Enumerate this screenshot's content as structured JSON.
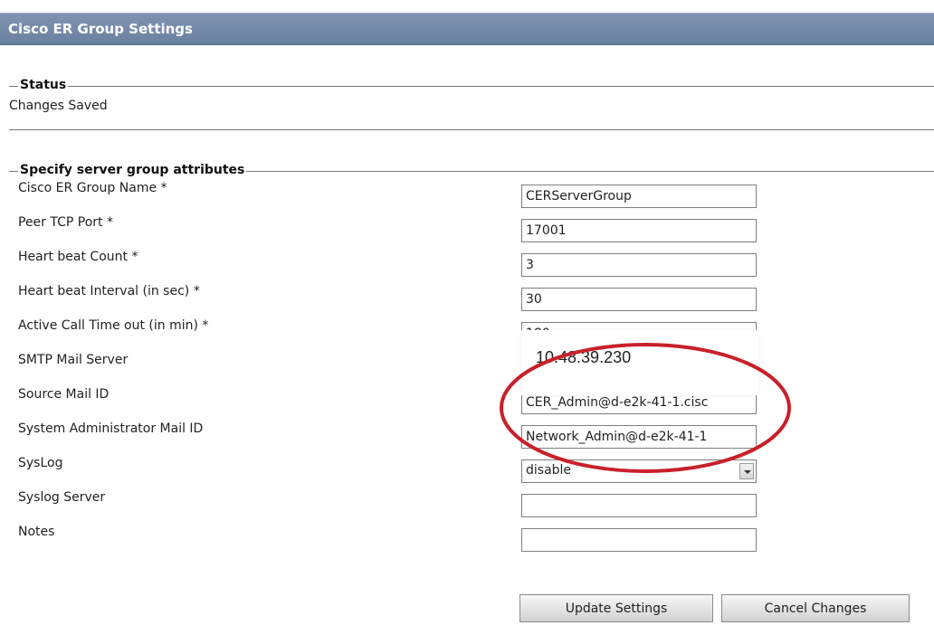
{
  "header": {
    "title": "Cisco ER Group Settings"
  },
  "status": {
    "legend": "Status",
    "message": "Changes Saved"
  },
  "attributes": {
    "legend": "Specify server group attributes",
    "rows": [
      {
        "label": "Cisco ER Group Name *",
        "value": "CERServerGroup"
      },
      {
        "label": "Peer TCP Port *",
        "value": "17001"
      },
      {
        "label": "Heart beat Count *",
        "value": "3"
      },
      {
        "label": "Heart beat Interval (in sec) *",
        "value": "30"
      },
      {
        "label": "Active Call Time out (in min) *",
        "value": "180"
      },
      {
        "label": "SMTP Mail Server",
        "value": ""
      },
      {
        "label": "Source Mail ID",
        "value": "CER_Admin@d-e2k-41-1.cisc"
      },
      {
        "label": "System Administrator Mail ID",
        "value": "Network_Admin@d-e2k-41-1"
      },
      {
        "label": "SysLog",
        "value": "disable"
      },
      {
        "label": "Syslog Server",
        "value": ""
      },
      {
        "label": "Notes",
        "value": ""
      }
    ]
  },
  "popup": {
    "text": "10.48.39.230"
  },
  "buttons": {
    "update": "Update Settings",
    "cancel": "Cancel Changes"
  },
  "colors": {
    "title_bar": "#7488a7",
    "highlight_ellipse": "#c8202a"
  }
}
